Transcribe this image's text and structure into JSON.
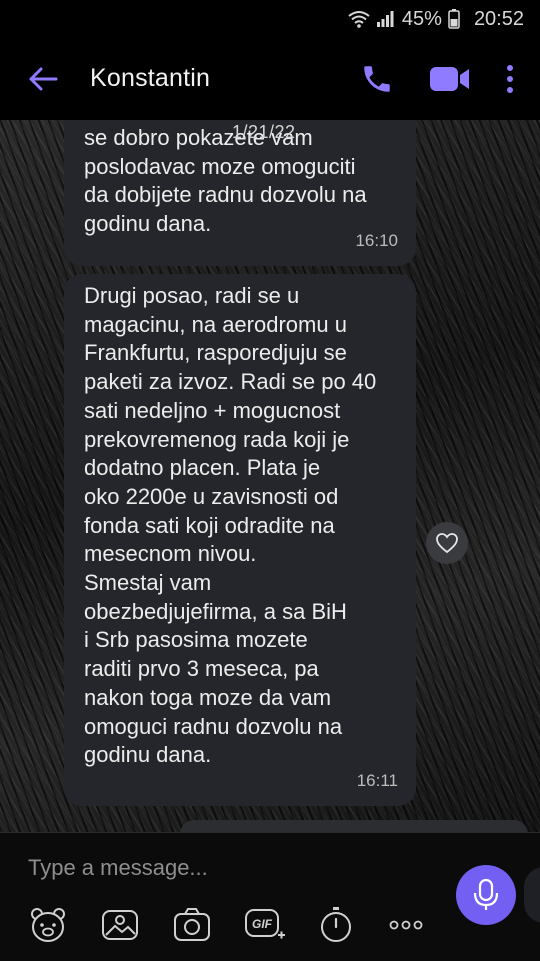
{
  "status_bar": {
    "battery": "45%",
    "time": "20:52",
    "icons": [
      "wifi-icon",
      "signal-icon",
      "battery-icon"
    ]
  },
  "header": {
    "contact_name": "Konstantin",
    "icons": [
      "back-arrow-icon",
      "phone-icon",
      "video-camera-icon",
      "more-vertical-icon"
    ],
    "accent_color": "#7360f2"
  },
  "date_overlay": "1/21/22",
  "messages": [
    {
      "text": "se dobro pokazete vam\nposlodavac moze omoguciti\nda dobijete radnu dozvolu na\ngodinu dana.",
      "time": "16:10"
    },
    {
      "text": "Drugi posao, radi se u\nmagacinu, na aerodromu u\nFrankfurtu, rasporedjuju se\npaketi za izvoz. Radi se po 40\nsati nedeljno + mogucnost\nprekovremenog rada koji je\ndodatno placen.  Plata je\noko 2200e u zavisnosti od\nfonda sati koji odradite na\nmesecnom nivou.\nSmestaj vam\nobezbedjujefirma, a sa BiH\ni Srb pasosima mozete\nraditi prvo 3 meseca, pa\nnakon toga moze da vam\nomoguci radnu dozvolu na\ngodinu dana.",
      "time": "16:11"
    }
  ],
  "composer": {
    "placeholder": "Type a message...",
    "toolbar_icons": [
      "sticker-icon",
      "gallery-icon",
      "camera-icon",
      "gif-icon",
      "timer-icon",
      "more-horizontal-icon"
    ],
    "gif_label": "GIF",
    "mic_icon": "microphone-icon"
  },
  "colors": {
    "bubble": "#24262b",
    "accent": "#7360f2",
    "background": "#000000"
  }
}
